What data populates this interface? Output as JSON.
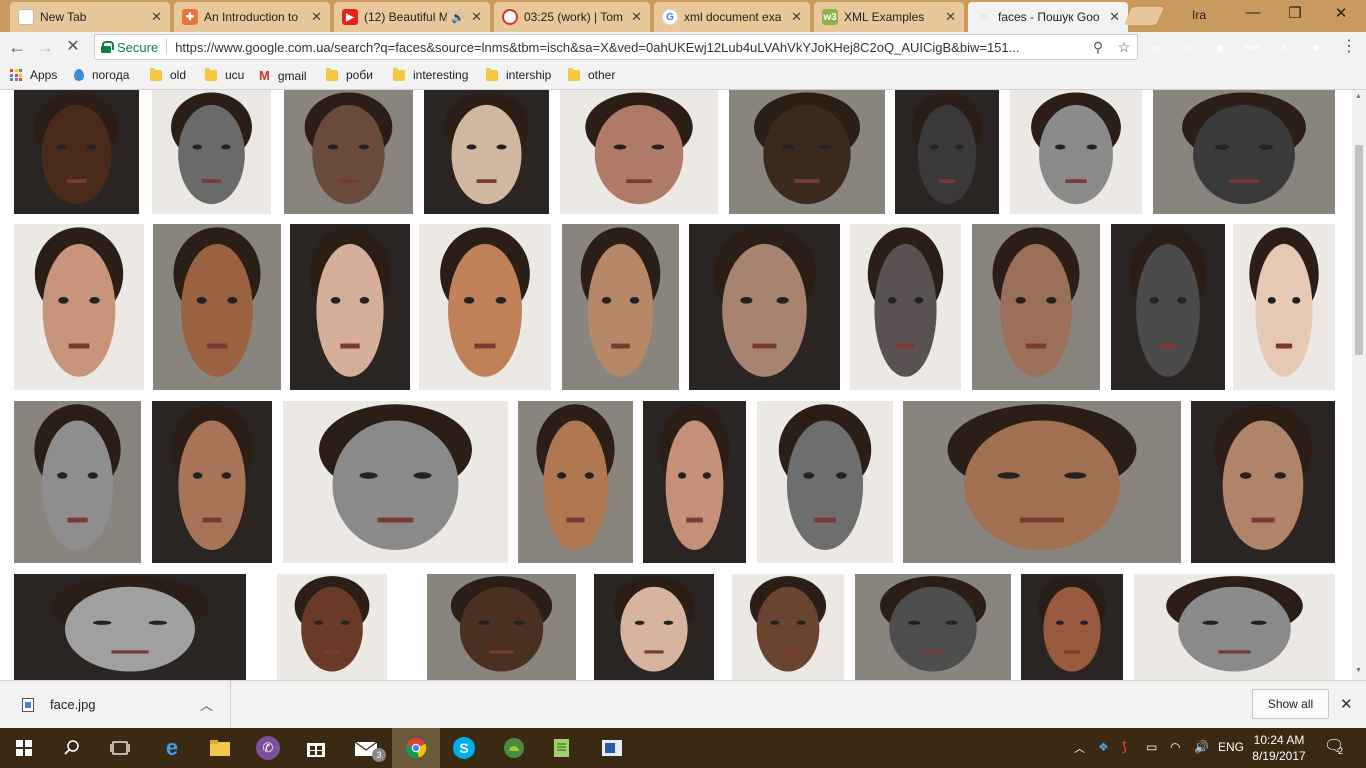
{
  "tabs": [
    {
      "title": "New Tab",
      "icon": "blank-page-icon",
      "active": false
    },
    {
      "title": "An Introduction to",
      "icon": "medical-cross-icon",
      "active": false
    },
    {
      "title": "(12) Beautiful M",
      "icon": "youtube-icon",
      "active": false
    },
    {
      "title": "03:25 (work) | Tom",
      "icon": "tomato-timer-icon",
      "active": false
    },
    {
      "title": "xml document exa",
      "icon": "google-icon",
      "active": false
    },
    {
      "title": "XML Examples",
      "icon": "xml-icon",
      "active": false
    },
    {
      "title": "faces - Пошук Goo",
      "icon": "google-icon",
      "active": true
    }
  ],
  "window": {
    "user": "Ira"
  },
  "toolbar": {
    "secure_label": "Secure",
    "url": "https://www.google.com.ua/search?q=faces&source=lnms&tbm=isch&sa=X&ved=0ahUKEwj12Lub4uLVAhVkYJoKHej8C2oQ_AUICigB&biw=151...",
    "extensions": [
      {
        "label": "m",
        "color": "#1cb5ac"
      },
      {
        "label": "G",
        "color": "#15c39a"
      },
      {
        "label": "◉",
        "color": "#555555"
      },
      {
        "label": "ABP",
        "color": "#c70d2c"
      },
      {
        "label": "A",
        "color": "#d9342b"
      },
      {
        "label": "✚",
        "color": "#d9342b"
      }
    ]
  },
  "bookmarks": [
    {
      "label": "Apps",
      "type": "apps"
    },
    {
      "label": "погода",
      "type": "weather"
    },
    {
      "label": "old",
      "type": "folder"
    },
    {
      "label": "ucu",
      "type": "folder"
    },
    {
      "label": "gmail",
      "type": "gmail"
    },
    {
      "label": "роби",
      "type": "folder"
    },
    {
      "label": "interesting",
      "type": "folder"
    },
    {
      "label": "intership",
      "type": "folder"
    },
    {
      "label": "other",
      "type": "folder"
    }
  ],
  "results": {
    "rows": [
      [
        "#4a2a1a",
        "#6a6a6a",
        "#6a4a3a",
        "#d0b8a0",
        "#b07a68",
        "#3a2a1e",
        "#3a3838",
        "#8a8a8a",
        "#3a3a3a"
      ],
      [
        "#c8957a",
        "#9a6240",
        "#d4ae98",
        "#c08058",
        "#b68868",
        "#a88470",
        "#5a5252",
        "#9a7058",
        "#4a4a4a",
        "#e6c8b4"
      ],
      [
        "#8e8e8e",
        "#a87458",
        "#8a8a8a",
        "#b07850",
        "#c49078",
        "#6e6e6e",
        "#a07050",
        "#b08468"
      ],
      [
        "#a0a0a0",
        "#6a3a28",
        "#4a3020",
        "#d8b4a0",
        "#6a4430",
        "#4e4e4e",
        "#9a5a40",
        "#8a8a8a"
      ]
    ]
  },
  "download": {
    "file_name": "face.jpg",
    "show_all_label": "Show all"
  },
  "taskbar": {
    "language": "ENG",
    "time": "10:24 AM",
    "date": "8/19/2017",
    "mail_badge": "3",
    "notification_badge": "2"
  }
}
